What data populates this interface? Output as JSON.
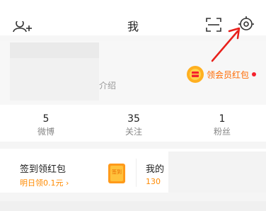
{
  "header": {
    "title": "我",
    "icons": [
      "add-friend-icon",
      "scan-icon",
      "settings-icon"
    ]
  },
  "profile": {
    "intro": "介绍",
    "vip_badge": "领会员红包"
  },
  "stats": [
    {
      "count": "5",
      "label": "微博"
    },
    {
      "count": "35",
      "label": "关注"
    },
    {
      "count": "1",
      "label": "粉丝"
    }
  ],
  "tasks": {
    "first": {
      "title": "签到领红包",
      "subtitle": "明日领0.1元",
      "chevron": "›",
      "envelope_text": "签到"
    },
    "second": {
      "title": "我的",
      "subtitle": "130"
    }
  },
  "colors": {
    "accent": "#ff8a00",
    "arrow": "#e8201b",
    "dot": "#f5222d"
  }
}
